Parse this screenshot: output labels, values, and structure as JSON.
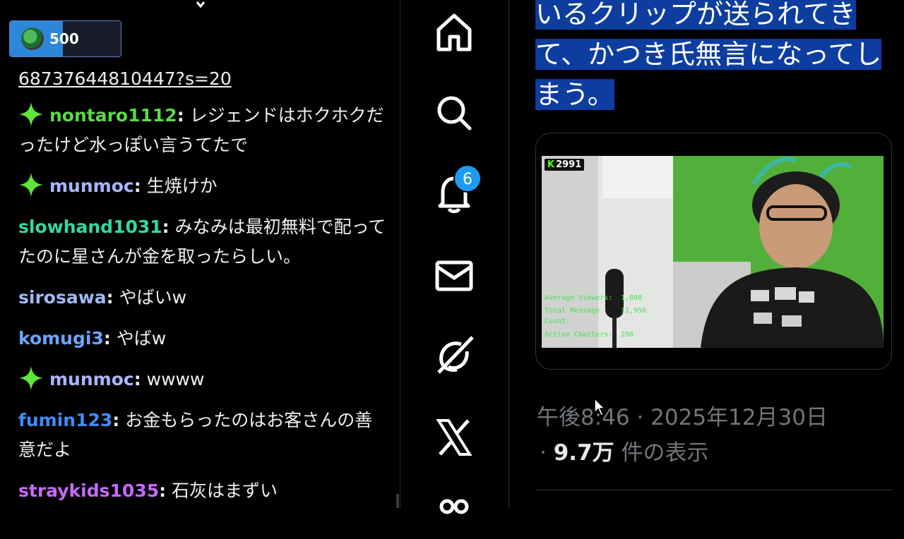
{
  "chat": {
    "points": "500",
    "points_fraction": 0.48,
    "link_text": "68737644810447?s=20",
    "messages": [
      {
        "user": "nontaro1112",
        "text": " レジェンドはホクホクだったけど水っぽい言うてたで",
        "color": "#5dd84a",
        "badge": true
      },
      {
        "user": "munmoc",
        "text": " 生焼けか",
        "color": "#a9b5ff",
        "badge": true
      },
      {
        "user": "slowhand1031",
        "text": " みなみは最初無料で配ってたのに星さんが金を取ったらしい。",
        "color": "#33d9a0",
        "badge": false
      },
      {
        "user": "sirosawa",
        "text": " やばいw",
        "color": "#9fb8f5",
        "badge": false
      },
      {
        "user": "komugi3",
        "text": " やばw",
        "color": "#6aa6ff",
        "badge": false
      },
      {
        "user": "munmoc",
        "text": " wwww",
        "color": "#a9b5ff",
        "badge": true
      },
      {
        "user": "fumin123",
        "text": " お金もらったのはお客さんの善意だよ",
        "color": "#3f8cff",
        "badge": false
      },
      {
        "user": "straykids1035",
        "text": " 石灰はまずい",
        "color": "#c46bff",
        "badge": false
      }
    ]
  },
  "nav": {
    "items": [
      "home-icon",
      "search-icon",
      "bell-icon",
      "mail-icon",
      "grok-icon",
      "x-logo-icon",
      "communities-icon"
    ],
    "notification_count": "6"
  },
  "tweet": {
    "text": "いるクリップが送られてきて、かつき氏無言になってしまう。",
    "time": "午後8:46 · 2025年12月30日",
    "views_prefix": "·",
    "views_count": "9.7万",
    "views_suffix": " 件の表示",
    "video": {
      "viewer_count": "2991",
      "stats": [
        {
          "label": "Average Viewers:",
          "value": "1,008"
        },
        {
          "label": "Total Message",
          "value": "11,956"
        },
        {
          "label": "Count:",
          "value": ""
        },
        {
          "label": "Active Chatters:",
          "value": "288"
        }
      ]
    }
  },
  "colors": {
    "accent": "#1d9bf0",
    "selection": "#0d3d9f",
    "kick_green": "#53fc18"
  }
}
